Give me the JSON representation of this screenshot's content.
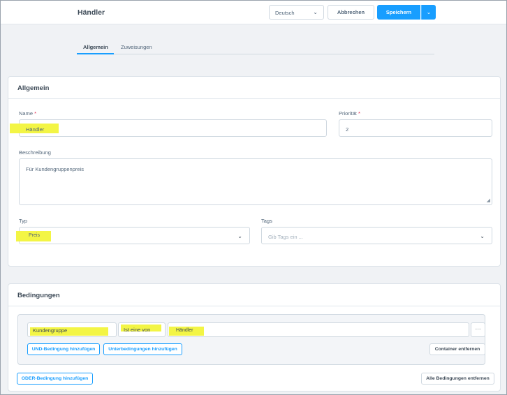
{
  "header": {
    "title": "Händler",
    "language": "Deutsch",
    "cancel_label": "Abbrechen",
    "save_label": "Speichern"
  },
  "tabs": [
    {
      "label": "Allgemein",
      "active": true
    },
    {
      "label": "Zuweisungen",
      "active": false
    }
  ],
  "general": {
    "section_title": "Allgemein",
    "name_label": "Name",
    "name_value": "Händler",
    "priority_label": "Priorität",
    "priority_value": "2",
    "required_mark": "*",
    "description_label": "Beschreibung",
    "description_value": "Für Kundengruppenpreis",
    "type_label": "Typ",
    "type_value": "Preis",
    "tags_label": "Tags",
    "tags_placeholder": "Gib Tags ein ..."
  },
  "conditions": {
    "section_title": "Bedingungen",
    "field_value": "Kundengruppe",
    "operator_value": "Ist eine von",
    "selected_value": "Händler",
    "more_label": "···",
    "add_and_label": "UND-Bedingung hinzufügen",
    "add_sub_label": "Unterbedingungen hinzufügen",
    "remove_container_label": "Container entfernen",
    "add_or_label": "ODER-Bedingung hinzufügen",
    "remove_all_label": "Alle Bedingungen entfernen"
  },
  "colors": {
    "accent": "#189eff",
    "highlight": "#f3f545",
    "required": "#e2264d"
  }
}
